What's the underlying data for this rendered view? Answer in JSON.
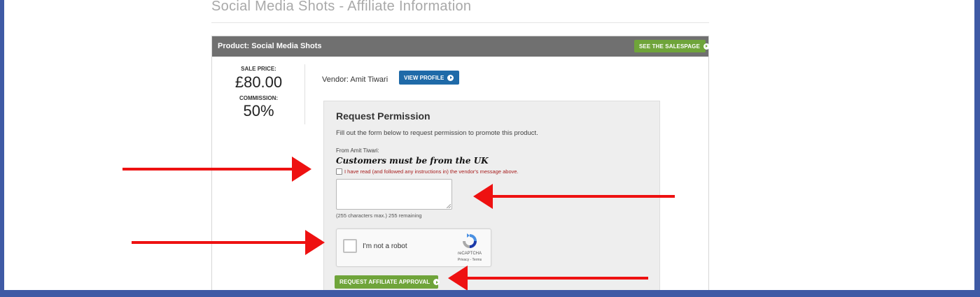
{
  "page": {
    "title": "Social Media Shots - Affiliate Information"
  },
  "product": {
    "header_label": "Product: Social Media Shots",
    "salespage_button": "SEE THE SALESPAGE",
    "sale_price_label": "SALE PRICE:",
    "sale_price": "£80.00",
    "commission_label": "COMMISSION:",
    "commission": "50%",
    "vendor_text": "Vendor: Amit Tiwari",
    "view_profile_button": "VIEW PROFILE"
  },
  "request": {
    "title": "Request Permission",
    "description": "Fill out the form below to request permission to promote this product.",
    "from_label": "From Amit Tiwari:",
    "vendor_message": "Customers must be from the UK",
    "acknowledge_label": "I have read (and followed any instructions in) the vendor's message above.",
    "textarea_value": "",
    "char_count": "(255 characters max.) 255 remaining",
    "submit_button": "REQUEST AFFILIATE APPROVAL"
  },
  "recaptcha": {
    "label": "I'm not a robot",
    "brand": "reCAPTCHA",
    "links": "Privacy - Terms"
  },
  "colors": {
    "frame_border": "#3f5aa5",
    "header_bg": "#707070",
    "green_button": "#6fa43a",
    "blue_button": "#1f6aa8",
    "annotation_arrow": "#ee1111",
    "warning_text": "#a82020"
  },
  "icons": {
    "play": "play-circle-icon",
    "recaptcha": "recaptcha-logo-icon",
    "arrow": "annotation-arrow-icon"
  }
}
